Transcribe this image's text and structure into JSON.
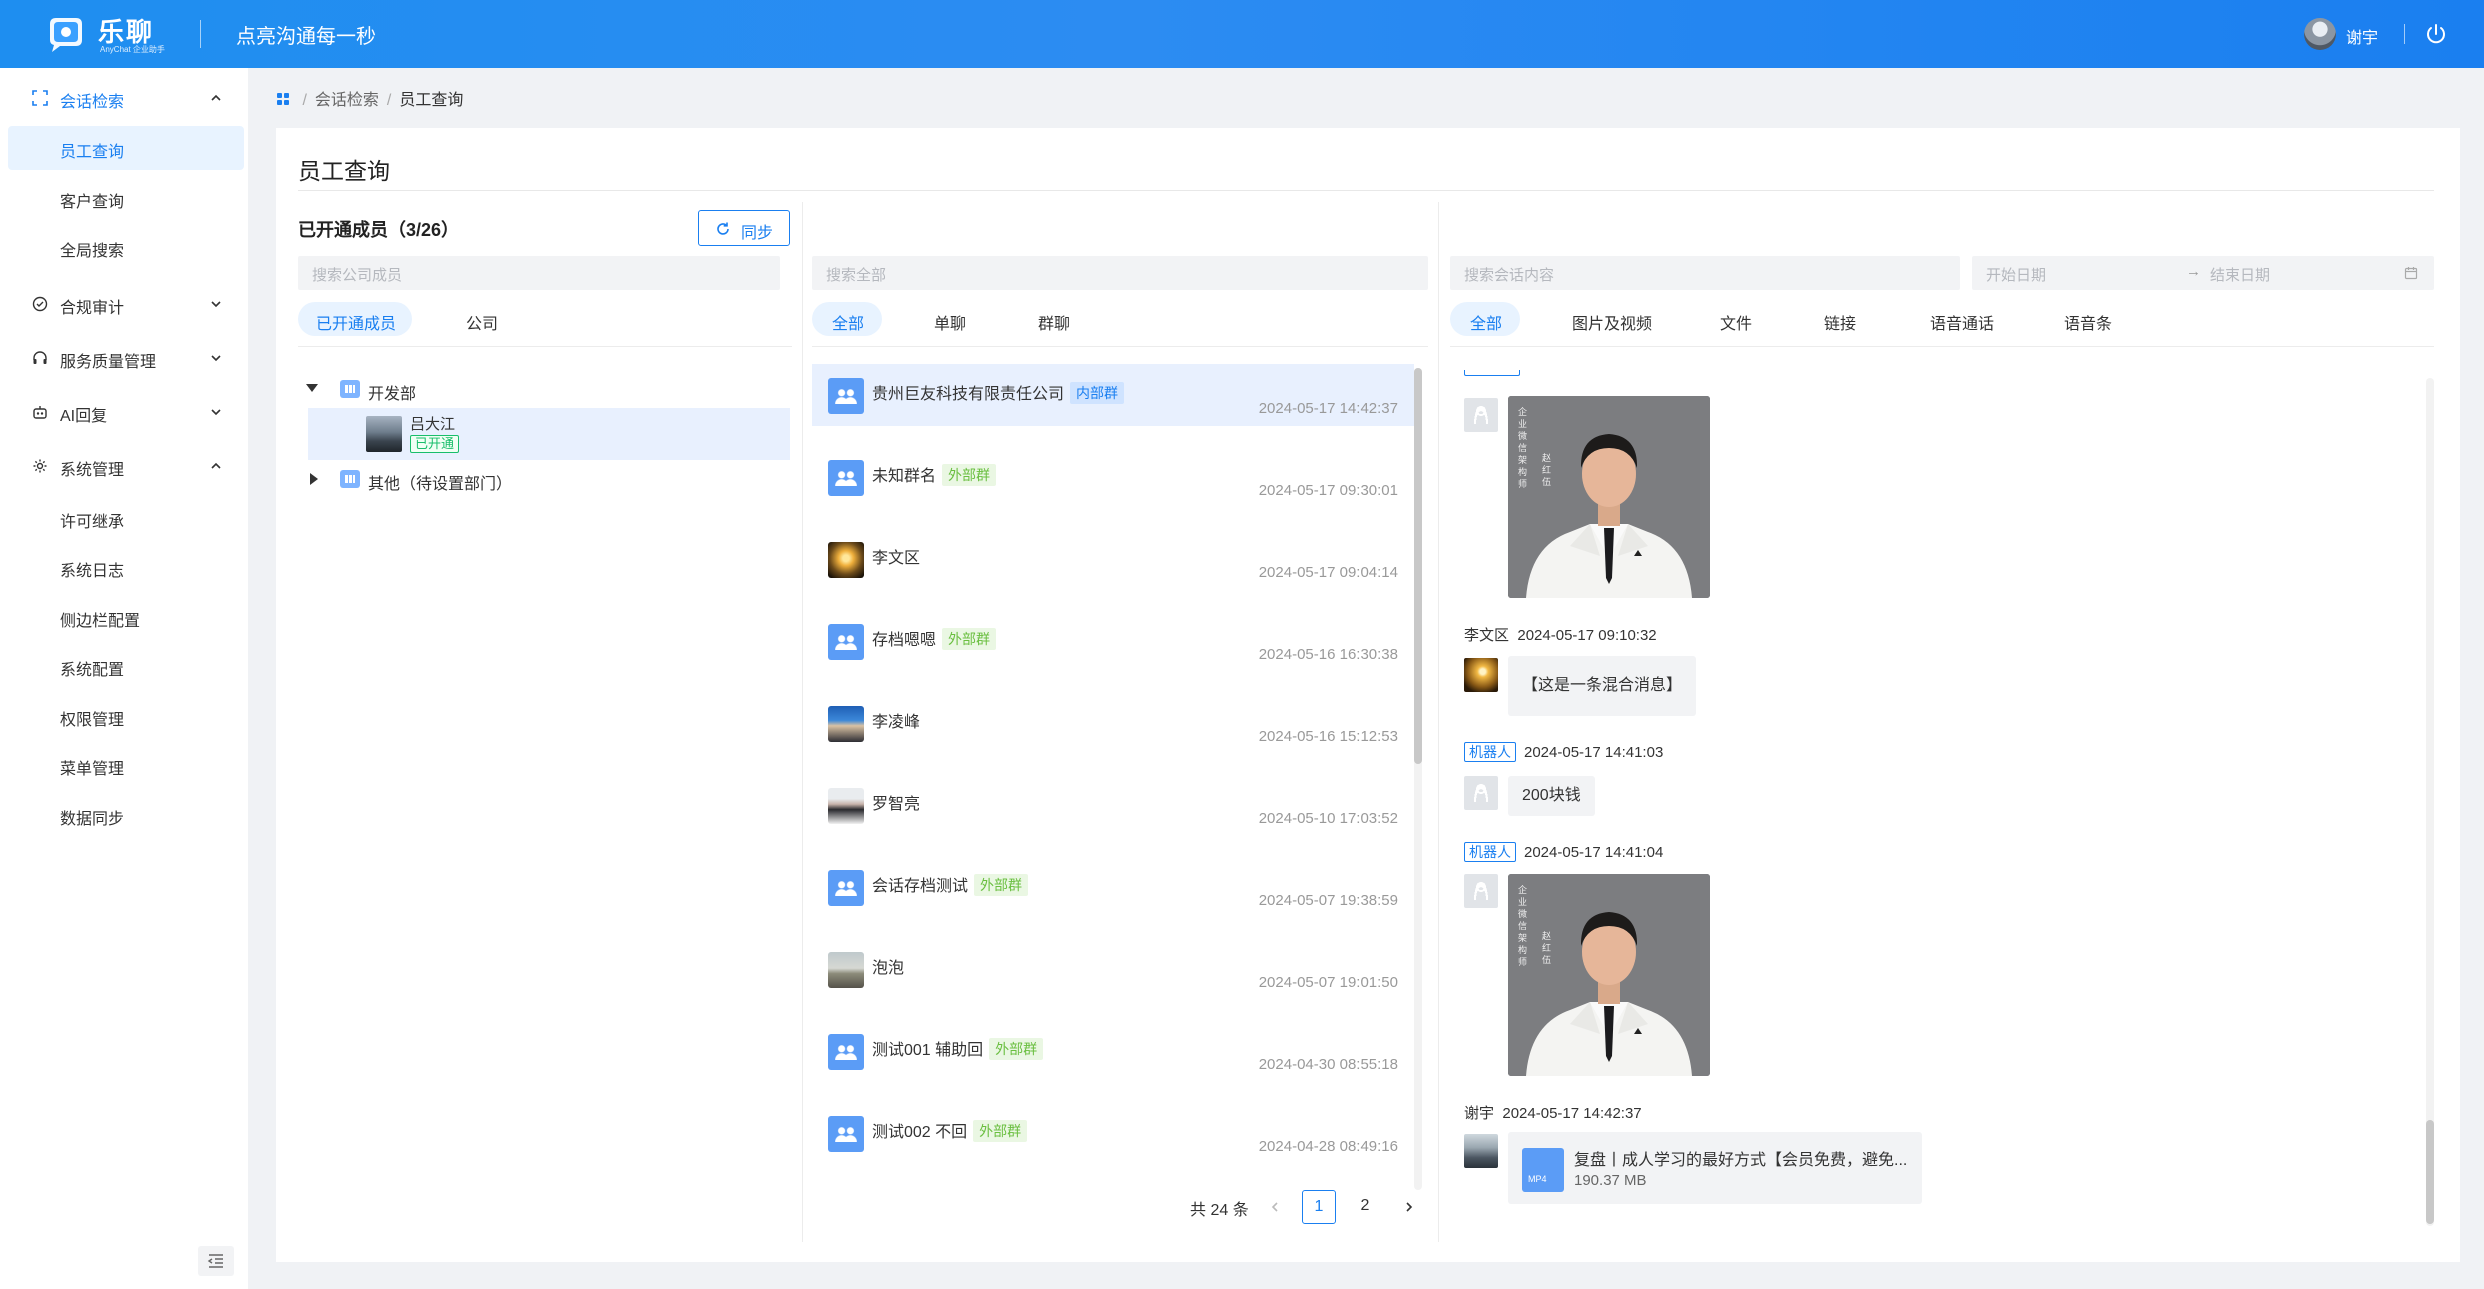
{
  "header": {
    "app_name": "乐聊",
    "app_sub": "AnyChat 企业助手",
    "slogan": "点亮沟通每一秒",
    "user": "谢宇"
  },
  "sidebar": {
    "groups": [
      {
        "label": "会话检索",
        "icon": "expand-icon",
        "expanded": true
      },
      {
        "label": "合规审计",
        "icon": "check-circle-icon",
        "expanded": false
      },
      {
        "label": "服务质量管理",
        "icon": "headset-icon",
        "expanded": false
      },
      {
        "label": "AI回复",
        "icon": "ai-icon",
        "expanded": false
      },
      {
        "label": "系统管理",
        "icon": "gear-icon",
        "expanded": true
      }
    ],
    "search_items": [
      "员工查询",
      "客户查询",
      "全局搜索"
    ],
    "system_items": [
      "许可继承",
      "系统日志",
      "侧边栏配置",
      "系统配置",
      "权限管理",
      "菜单管理",
      "数据同步"
    ]
  },
  "breadcrumb": {
    "parent": "会话检索",
    "current": "员工查询"
  },
  "page": {
    "title": "员工查询"
  },
  "members": {
    "title": "已开通成员（3/26）",
    "sync": "同步",
    "search_placeholder": "搜索公司成员",
    "tabs": [
      "已开通成员",
      "公司"
    ],
    "tree": {
      "dept1": "开发部",
      "member": "吕大江",
      "member_badge": "已开通",
      "dept2": "其他（待设置部门）"
    }
  },
  "conversations": {
    "search_placeholder": "搜索全部",
    "tabs": [
      "全部",
      "单聊",
      "群聊"
    ],
    "items": [
      {
        "name": "贵州巨友科技有限责任公司",
        "tag": "内部群",
        "tag_type": "in",
        "time": "2024-05-17 14:42:37",
        "avatar": "group"
      },
      {
        "name": "未知群名",
        "tag": "外部群",
        "tag_type": "out",
        "time": "2024-05-17 09:30:01",
        "avatar": "group"
      },
      {
        "name": "李文区",
        "tag": "",
        "tag_type": "",
        "time": "2024-05-17 09:04:14",
        "avatar": "sunset"
      },
      {
        "name": "存档嗯嗯",
        "tag": "外部群",
        "tag_type": "out",
        "time": "2024-05-16 16:30:38",
        "avatar": "group"
      },
      {
        "name": "李凌峰",
        "tag": "",
        "tag_type": "",
        "time": "2024-05-16 15:12:53",
        "avatar": "blue"
      },
      {
        "name": "罗智亮",
        "tag": "",
        "tag_type": "",
        "time": "2024-05-10 17:03:52",
        "avatar": "portrait"
      },
      {
        "name": "会话存档测试",
        "tag": "外部群",
        "tag_type": "out",
        "time": "2024-05-07 19:38:59",
        "avatar": "group"
      },
      {
        "name": "泡泡",
        "tag": "",
        "tag_type": "",
        "time": "2024-05-07 19:01:50",
        "avatar": "beach"
      },
      {
        "name": "测试001 辅助回",
        "tag": "外部群",
        "tag_type": "out",
        "time": "2024-04-30 08:55:18",
        "avatar": "group"
      },
      {
        "name": "测试002 不回",
        "tag": "外部群",
        "tag_type": "out",
        "time": "2024-04-28 08:49:16",
        "avatar": "group"
      }
    ],
    "pager": {
      "total": "共 24 条",
      "pages": [
        "1",
        "2"
      ],
      "current": "1"
    }
  },
  "messages": {
    "search_placeholder": "搜索会话内容",
    "start_date": "开始日期",
    "end_date": "结束日期",
    "tabs": [
      "全部",
      "图片及视频",
      "文件",
      "链接",
      "语音通话",
      "语音条"
    ],
    "photo_caption": [
      "企业微信架构师",
      "赵红伍"
    ],
    "items": [
      {
        "sender": "李文区",
        "time": "2024-05-17 09:10:32",
        "text": "【这是一条混合消息】"
      },
      {
        "sender": "机器人",
        "time": "2024-05-17 14:41:03",
        "text": "200块钱"
      },
      {
        "sender": "机器人",
        "time": "2024-05-17 14:41:04",
        "text": ""
      },
      {
        "sender": "谢宇",
        "time": "2024-05-17 14:42:37",
        "text": ""
      }
    ],
    "file": {
      "type": "MP4",
      "name": "复盘丨成人学习的最好方式【会员免费，避免...",
      "size": "190.37 MB"
    }
  },
  "colors": {
    "brand": "#1a7ff0",
    "out_tag": "#6abf40",
    "active_badge": "#19be6b"
  }
}
